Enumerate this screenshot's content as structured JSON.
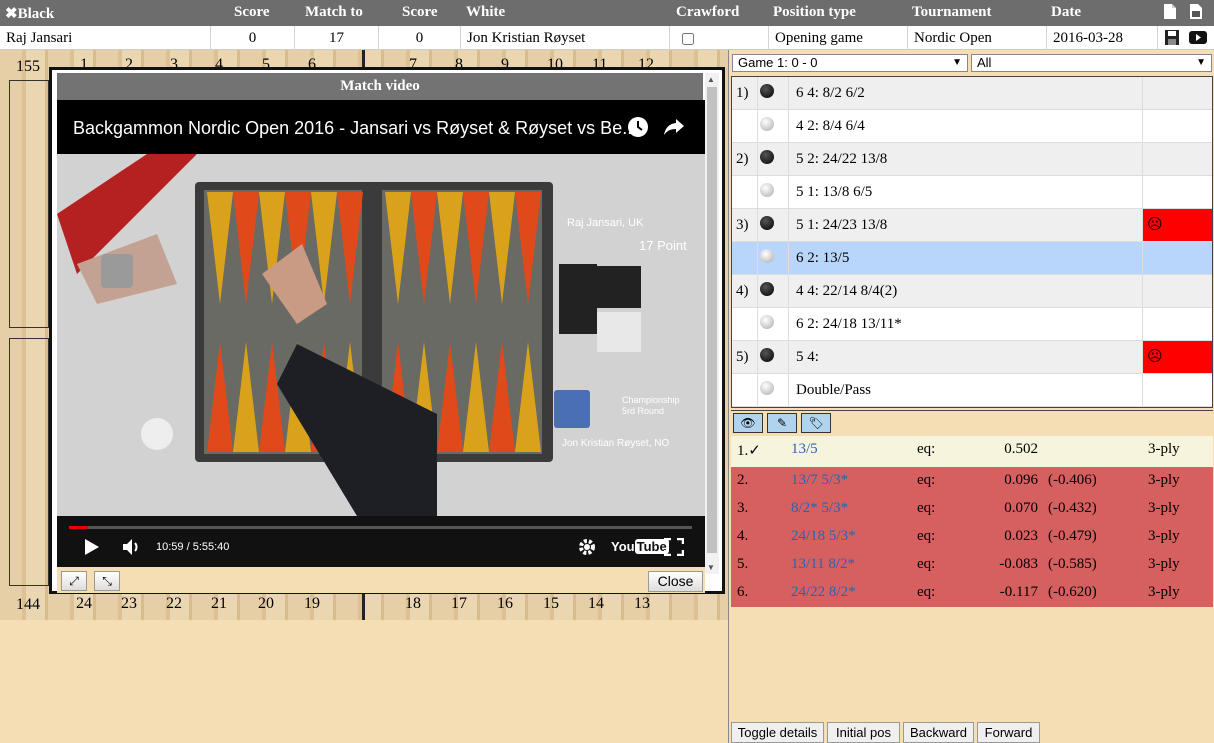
{
  "header": {
    "black_label": "✖Black",
    "score1_label": "Score",
    "match_label": "Match to",
    "score2_label": "Score",
    "white_label": "White",
    "crawford_label": "Crawford",
    "ptype_label": "Position type",
    "tournament_label": "Tournament",
    "date_label": "Date"
  },
  "match": {
    "black": "Raj Jansari",
    "score_black": "0",
    "match_to": "17",
    "score_white": "0",
    "white": "Jon Kristian Røyset",
    "crawford": false,
    "position_type": "Opening game",
    "tournament": "Nordic Open",
    "date": "2016-03-28"
  },
  "board": {
    "pip_top": "155",
    "pip_bottom": "144",
    "top_numbers": [
      "1",
      "2",
      "3",
      "4",
      "5",
      "6",
      "7",
      "8",
      "9",
      "10",
      "11",
      "12"
    ],
    "bottom_numbers": [
      "24",
      "23",
      "22",
      "21",
      "20",
      "19",
      "18",
      "17",
      "16",
      "15",
      "14",
      "13"
    ]
  },
  "video": {
    "panel_title": "Match video",
    "video_title": "Backgammon Nordic Open 2016 - Jansari vs Røyset & Røyset vs Be...",
    "time": "10:59 / 5:55:40",
    "progress": 0.031,
    "overlay_player1": "Raj Jansari, UK",
    "overlay_points": "17 Point",
    "overlay_round": "Championship\n5rd Round",
    "overlay_player2": "Jon Kristian Røyset, NO",
    "close_label": "Close"
  },
  "right": {
    "game_select": "Game 1: 0 - 0",
    "filter_select": "All",
    "moves": [
      {
        "no": "1)",
        "color": "black",
        "text": "6 4: 8/2 6/2",
        "flag": ""
      },
      {
        "no": "",
        "color": "white",
        "text": "4 2: 8/4 6/4",
        "flag": ""
      },
      {
        "no": "2)",
        "color": "black",
        "text": "5 2: 24/22 13/8",
        "flag": ""
      },
      {
        "no": "",
        "color": "white",
        "text": "5 1: 13/8 6/5",
        "flag": ""
      },
      {
        "no": "3)",
        "color": "black",
        "text": "5 1: 24/23 13/8",
        "flag": "☹"
      },
      {
        "no": "",
        "color": "white",
        "text": "6 2: 13/5",
        "flag": ""
      },
      {
        "no": "4)",
        "color": "black",
        "text": "4 4: 22/14 8/4(2)",
        "flag": ""
      },
      {
        "no": "",
        "color": "white",
        "text": "6 2: 24/18 13/11*",
        "flag": ""
      },
      {
        "no": "5)",
        "color": "black",
        "text": "5 4:",
        "flag": "☹"
      },
      {
        "no": "",
        "color": "white",
        "text": "Double/Pass",
        "flag": ""
      }
    ],
    "analysis": [
      {
        "rank": "1.✓",
        "move": "13/5",
        "eq_label": "eq:",
        "eq": "0.502",
        "diff": "",
        "ply": "3-ply"
      },
      {
        "rank": "2.",
        "move": "13/7 5/3*",
        "eq_label": "eq:",
        "eq": "0.096",
        "diff": "(-0.406)",
        "ply": "3-ply"
      },
      {
        "rank": "3.",
        "move": "8/2* 5/3*",
        "eq_label": "eq:",
        "eq": "0.070",
        "diff": "(-0.432)",
        "ply": "3-ply"
      },
      {
        "rank": "4.",
        "move": "24/18 5/3*",
        "eq_label": "eq:",
        "eq": "0.023",
        "diff": "(-0.479)",
        "ply": "3-ply"
      },
      {
        "rank": "5.",
        "move": "13/11 8/2*",
        "eq_label": "eq:",
        "eq": "-0.083",
        "diff": "(-0.585)",
        "ply": "3-ply"
      },
      {
        "rank": "6.",
        "move": "24/22 8/2*",
        "eq_label": "eq:",
        "eq": "-0.117",
        "diff": "(-0.620)",
        "ply": "3-ply"
      }
    ],
    "buttons": {
      "toggle": "Toggle details",
      "initial": "Initial pos",
      "backward": "Backward",
      "forward": "Forward"
    }
  },
  "colors": {
    "header_bg": "#6d6d6d",
    "selected_row": "#b8d6fb",
    "bad_flag": "#ff0000",
    "analysis_best": "#f6f4dc",
    "analysis_other": "#d66060",
    "link_blue": "#2a64b0"
  }
}
